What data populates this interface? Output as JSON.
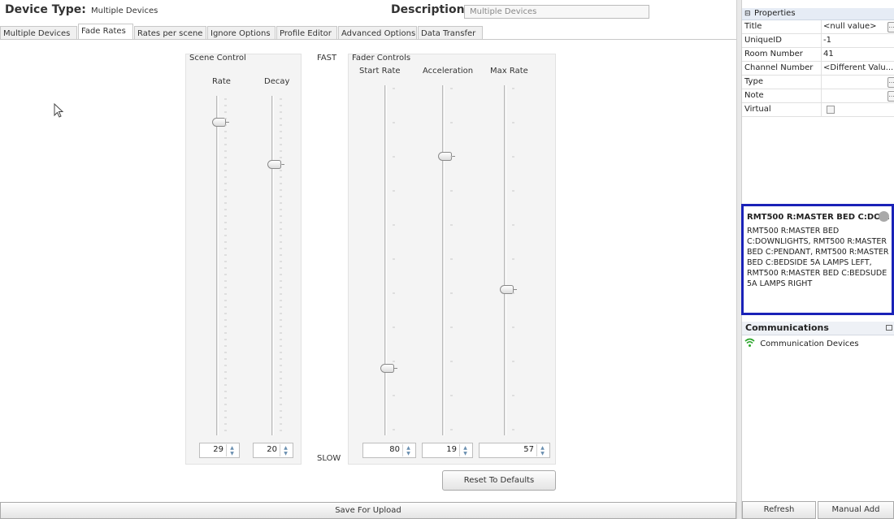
{
  "header": {
    "device_type_label": "Device Type:",
    "device_type_value": "Multiple Devices",
    "description_label": "Description:",
    "description_value": "Multiple Devices"
  },
  "tabs": [
    {
      "label": "Multiple Devices",
      "active": false
    },
    {
      "label": "Fade Rates",
      "active": true
    },
    {
      "label": "Rates per scene",
      "active": false
    },
    {
      "label": "Ignore Options",
      "active": false
    },
    {
      "label": "Profile Editor",
      "active": false
    },
    {
      "label": "Advanced Options",
      "active": false
    },
    {
      "label": "Data Transfer",
      "active": false
    }
  ],
  "scene_control": {
    "title": "Scene Control",
    "sliders": [
      {
        "label": "Rate",
        "value": "29"
      },
      {
        "label": "Decay",
        "value": "20"
      }
    ]
  },
  "speed_labels": {
    "fast": "FAST",
    "slow": "SLOW"
  },
  "fader_controls": {
    "title": "Fader Controls",
    "sliders": [
      {
        "label": "Start Rate",
        "value": "80"
      },
      {
        "label": "Acceleration",
        "value": "19"
      },
      {
        "label": "Max Rate",
        "value": "57"
      }
    ]
  },
  "reset_button": "Reset To Defaults",
  "save_bar": "Save For Upload",
  "properties": {
    "header": "Properties",
    "rows": [
      {
        "key": "Title",
        "value": "<null value>",
        "ellipsis": true
      },
      {
        "key": "UniqueID",
        "value": "-1",
        "ellipsis": false
      },
      {
        "key": "Room Number",
        "value": "41",
        "ellipsis": false
      },
      {
        "key": "Channel Number",
        "value": "<Different Valu...",
        "ellipsis": false
      },
      {
        "key": "Type",
        "value": "",
        "ellipsis": true
      },
      {
        "key": "Note",
        "value": "",
        "ellipsis": true
      },
      {
        "key": "Virtual",
        "value": "",
        "checkbox": true
      }
    ]
  },
  "selection_box": {
    "title": "RMT500 R:MASTER BED C:DO...",
    "body": "RMT500 R:MASTER BED C:DOWNLIGHTS, RMT500 R:MASTER BED C:PENDANT, RMT500 R:MASTER BED C:BEDSIDE 5A LAMPS LEFT, RMT500 R:MASTER BED C:BEDSUDE 5A LAMPS RIGHT",
    "border_color": "#1a22b8"
  },
  "communications": {
    "header": "Communications",
    "item": "Communication Devices"
  },
  "buttons": {
    "refresh": "Refresh",
    "manual_add": "Manual Add"
  }
}
